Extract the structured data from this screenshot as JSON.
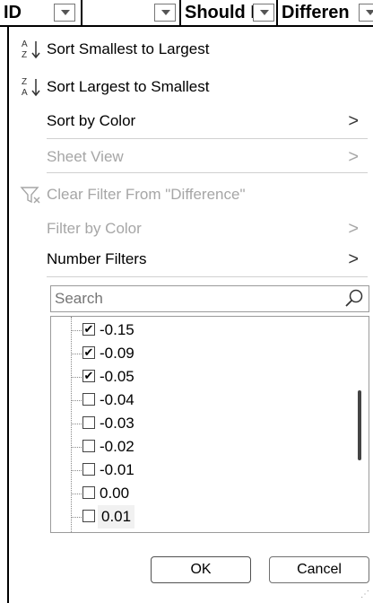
{
  "header": {
    "columns": [
      {
        "label": "ID"
      },
      {
        "label": ""
      },
      {
        "label": "Should I"
      },
      {
        "label": "Differen"
      }
    ]
  },
  "menu": {
    "sort_asc": "Sort Smallest to Largest",
    "sort_desc": "Sort Largest to Smallest",
    "sort_by_color": "Sort by Color",
    "sheet_view": "Sheet View",
    "clear_filter": "Clear Filter From \"Difference\"",
    "filter_by_color": "Filter by Color",
    "number_filters": "Number Filters",
    "submenu_arrow": ">"
  },
  "search": {
    "placeholder": "Search"
  },
  "values": [
    {
      "label": "-0.15",
      "checked": true
    },
    {
      "label": "-0.09",
      "checked": true
    },
    {
      "label": "-0.05",
      "checked": true
    },
    {
      "label": "-0.04",
      "checked": false
    },
    {
      "label": "-0.03",
      "checked": false
    },
    {
      "label": "-0.02",
      "checked": false
    },
    {
      "label": "-0.01",
      "checked": false
    },
    {
      "label": "0.00",
      "checked": false
    },
    {
      "label": "0.01",
      "checked": false
    }
  ],
  "buttons": {
    "ok": "OK",
    "cancel": "Cancel"
  },
  "icons": {
    "sort_asc": "sort-ascending-icon",
    "sort_desc": "sort-descending-icon",
    "clear_filter": "funnel-clear-icon",
    "search": "magnifier-icon",
    "dropdown": "dropdown-arrow-icon"
  },
  "colors": {
    "disabled_text": "#a6a6a6",
    "border": "#9a9a9a"
  }
}
